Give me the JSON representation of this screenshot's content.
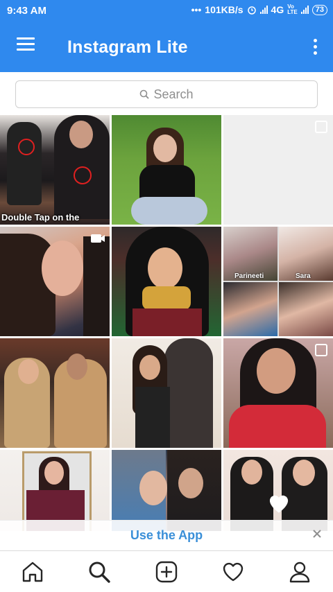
{
  "status_bar": {
    "time": "9:43 AM",
    "speed": "101KB/s",
    "network": "4G",
    "battery": "73"
  },
  "app_bar": {
    "title": "Instagram Lite"
  },
  "search": {
    "placeholder": "Search"
  },
  "grid": {
    "tiles": [
      {
        "caption": "Double Tap on the"
      },
      {
        "caption": ""
      },
      {
        "caption": ""
      },
      {
        "caption": ""
      },
      {
        "caption": ""
      },
      {
        "caption": "",
        "labels": [
          "Parineeti",
          "Sara"
        ]
      },
      {
        "caption": ""
      },
      {
        "caption": ""
      },
      {
        "caption": ""
      },
      {
        "caption": ""
      },
      {
        "caption": ""
      },
      {
        "caption": ""
      }
    ]
  },
  "banner": {
    "label": "Use the App"
  },
  "bottom_nav": {
    "items": [
      "home-icon",
      "search-icon",
      "new-post-icon",
      "activity-icon",
      "profile-icon"
    ]
  },
  "colors": {
    "primary": "#2f89ee",
    "link": "#3a8fd8"
  }
}
